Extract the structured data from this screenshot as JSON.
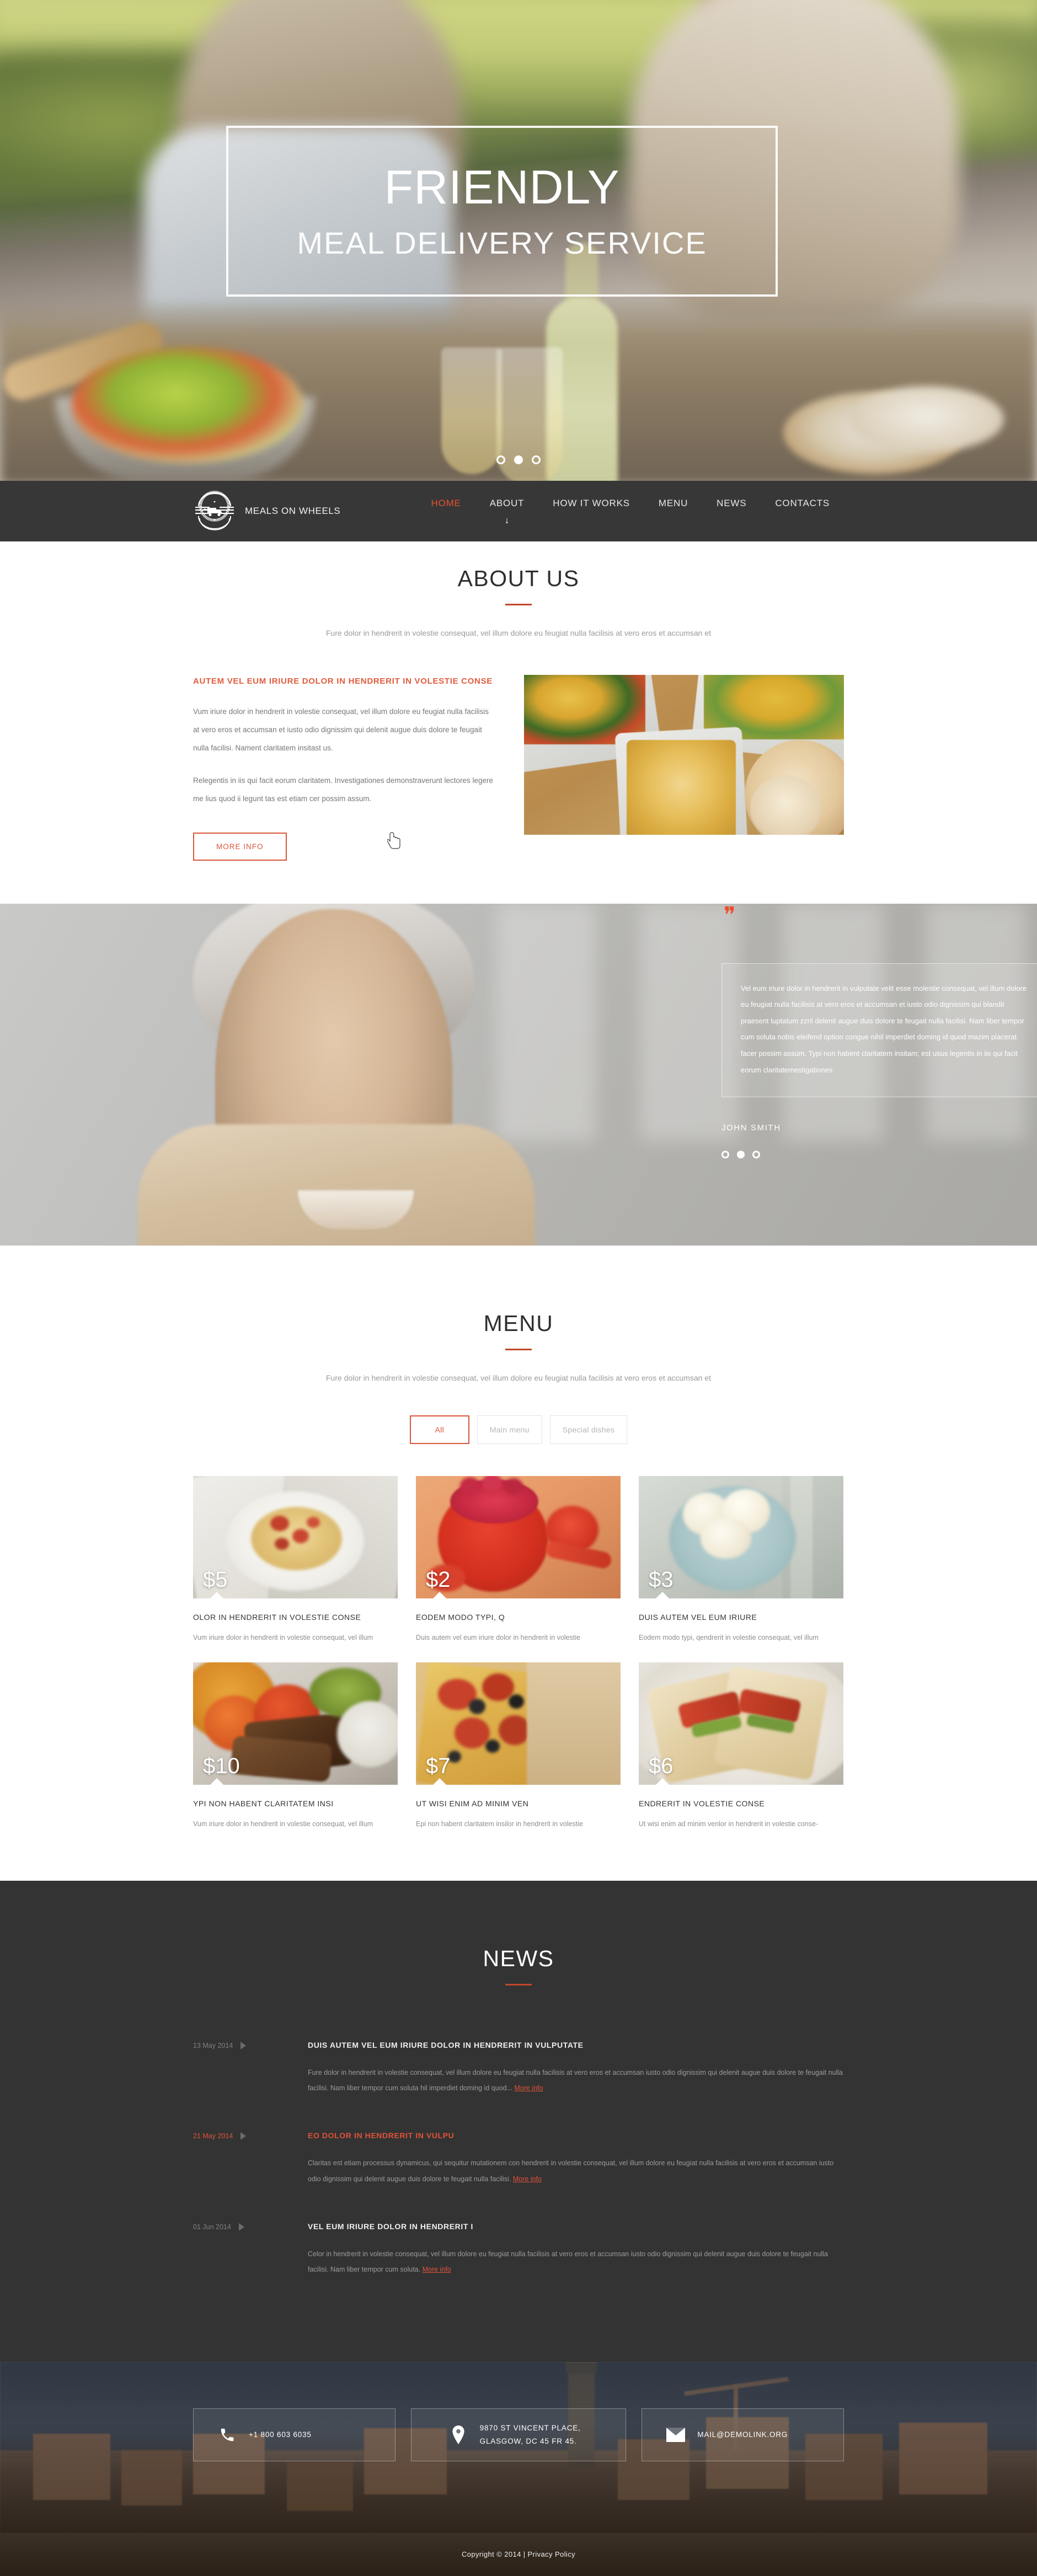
{
  "hero": {
    "title": "FRIENDLY",
    "subtitle": "MEAL DELIVERY SERVICE",
    "slide_count": 3,
    "active_slide": 2
  },
  "nav": {
    "brand": "MEALS ON WHEELS",
    "logo_icon": "delivery-truck-badge-icon",
    "items": [
      {
        "label": "HOME",
        "active": true
      },
      {
        "label": "ABOUT",
        "active": false,
        "has_arrow": true
      },
      {
        "label": "HOW IT WORKS",
        "active": false
      },
      {
        "label": "MENU",
        "active": false
      },
      {
        "label": "NEWS",
        "active": false
      },
      {
        "label": "CONTACTS",
        "active": false
      }
    ],
    "dropdown_arrow": "↓"
  },
  "about": {
    "title": "ABOUT US",
    "lead": "Fure dolor in hendrerit in volestie consequat, vel illum dolore eu feugiat nulla facilisis at vero eros et accumsan et",
    "heading": "AUTEM VEL EUM IRIURE DOLOR IN HENDRERIT IN VOLESTIE CONSE",
    "paragraph_1": "Vum iriure dolor in hendrerit in volestie consequat, vel illum dolore eu feugiat nulla facilisis at vero eros et accumsan et iusto odio dignissim qui  delenit augue duis dolore te feugait nulla facilisi. Nament claritatem insitast us.",
    "paragraph_2": "Relegentis in iis qui facit eorum claritatem. Investigationes demonstraverunt lectores legere me lius quod ii legunt tas est etiam cer possim assum.",
    "button": "MORE INFO"
  },
  "testimonial": {
    "quote_mark": "❞",
    "text": "Vel eum iriure dolor in hendrerit in vulputate velit esse molestie consequat, vel illum dolore eu feugiat nulla facilisis at vero eros et accumsan et iusto odio dignissim qui blandit praesent luptatum zzril delenit augue duis dolore te feugait nulla facilisi. Nam liber tempor cum soluta nobis eleifend option congue nihil imperdiet doming id quod mazim placerat facer possim assum. Typi non habent claritatem insitam; est usus legentis in iis qui facit eorum claritatemestigationes",
    "author": "JOHN SMITH",
    "slide_count": 3,
    "active_slide": 2
  },
  "menu": {
    "title": "MENU",
    "lead": "Fure dolor in hendrerit in volestie consequat, vel illum dolore eu feugiat nulla facilisis at vero eros et accumsan et",
    "filters": [
      {
        "label": "All",
        "active": true
      },
      {
        "label": "Main menu",
        "active": false
      },
      {
        "label": "Special dishes",
        "active": false
      }
    ],
    "items": [
      {
        "price": "$5",
        "title": "OLOR IN HENDRERIT IN VOLESTIE CONSE",
        "desc": "Vum iriure dolor in hendrerit in volestie consequat, vel illum",
        "image": "pasta-with-tomato-on-white-plate"
      },
      {
        "price": "$2",
        "title": "EODEM MODO TYPI, Q",
        "desc": "Duis autem vel eum iriure  dolor in hendrerit in volestie",
        "image": "raspberries-in-red-ramekin"
      },
      {
        "price": "$3",
        "title": "DUIS AUTEM VEL EUM IRIURE",
        "desc": "Eodem modo typi, qendrerit in volestie consequat, vel illum",
        "image": "vanilla-ice-cream-scoops-in-bowl"
      },
      {
        "price": "$10",
        "title": "YPI NON HABENT CLARITATEM INSI",
        "desc": "Vum iriure dolor in hendrerit in volestie consequat, vel illum",
        "image": "grilled-steak-with-vegetables"
      },
      {
        "price": "$7",
        "title": "UT WISI ENIM AD MINIM VEN",
        "desc": "Epi non habent claritatem insilor in hendrerit in volestie",
        "image": "pizza-slice-with-olives"
      },
      {
        "price": "$6",
        "title": "ENDRERIT IN VOLESTIE CONSE",
        "desc": "Ut wisi enim ad minim venlor in hendrerit in volestie conse-",
        "image": "wrap-sandwich-halves-on-plate"
      }
    ]
  },
  "news": {
    "title": "NEWS",
    "items": [
      {
        "date": "13 May 2014",
        "title": "DUIS AUTEM VEL EUM IRIURE DOLOR IN HENDRERIT IN VULPUTATE",
        "text": "Fure dolor in hendrerit in volestie consequat, vel illum dolore eu feugiat nulla facilisis at vero eros et accumsan  iusto odio dignissim qui  delenit augue duis dolore te feugait nulla facilisi. Nam liber tempor cum soluta hil imperdiet doming id quod... ",
        "link": "More info",
        "active": false
      },
      {
        "date": "21 May 2014",
        "title": "EO DOLOR IN HENDRERIT IN VULPU",
        "text": "Claritas est etiam processus dynamicus, qui sequitur mutationem con hendrerit in volestie consequat, vel illum dolore eu feugiat nulla facilisis at vero eros et accumsan  iusto odio dignissim qui  delenit augue duis dolore te feugait nulla facilisi. ",
        "link": "More info",
        "active": true
      },
      {
        "date": "01 Jun 2014",
        "title": "VEL EUM IRIURE DOLOR IN HENDRERIT I",
        "text": "Celor in hendrerit in volestie consequat, vel illum dolore eu feugiat nulla facilisis at vero eros et accumsan  iusto odio dignissim qui  delenit augue duis dolore te feugait nulla facilisi. Nam liber tempor cum soluta. ",
        "link": "More info",
        "active": false
      }
    ]
  },
  "contact": {
    "phone": {
      "icon": "phone-icon",
      "text": "+1 800 603 6035"
    },
    "address": {
      "icon": "map-pin-icon",
      "line1": "9870 ST VINCENT PLACE,",
      "line2": "GLASGOW, DC 45 FR 45."
    },
    "email": {
      "icon": "envelope-icon",
      "text": "MAIL@DEMOLINK.ORG"
    }
  },
  "footer": {
    "copyright": "Copyright © 2014 | ",
    "privacy": "Privacy Policy"
  },
  "colors": {
    "accent": "#d9573a",
    "accent_bright": "#e8512f",
    "dark": "#373737",
    "news_bg": "#333333"
  }
}
